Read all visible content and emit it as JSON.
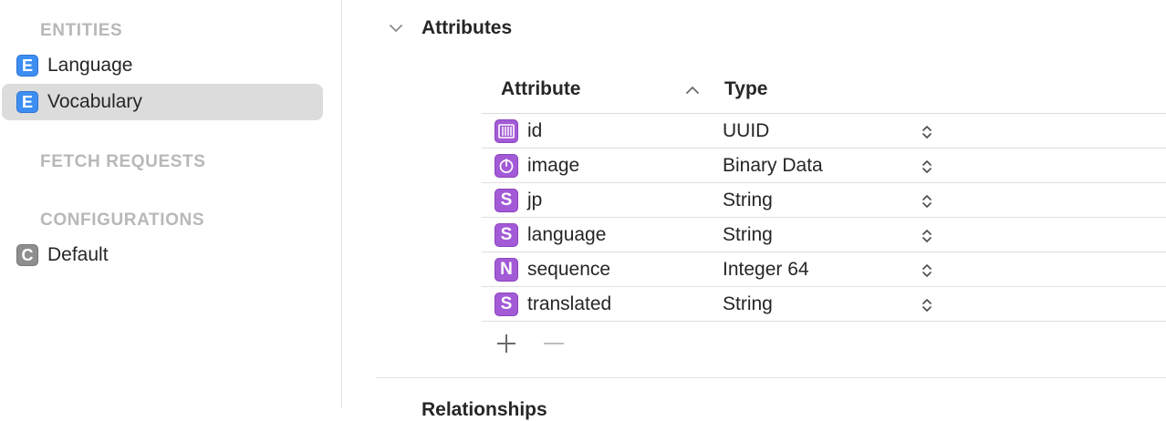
{
  "sidebar": {
    "entities_header": "ENTITIES",
    "entities": [
      {
        "badge": "E",
        "label": "Language",
        "selected": false
      },
      {
        "badge": "E",
        "label": "Vocabulary",
        "selected": true
      }
    ],
    "fetch_requests_header": "FETCH REQUESTS",
    "configurations_header": "CONFIGURATIONS",
    "configurations": [
      {
        "badge": "C",
        "label": "Default"
      }
    ]
  },
  "main": {
    "section_title": "Attributes",
    "next_section_title": "Relationships",
    "table": {
      "col_attribute": "Attribute",
      "col_type": "Type",
      "rows": [
        {
          "icon": "uuid-icon",
          "badge": "",
          "name": "id",
          "type": "UUID"
        },
        {
          "icon": "binary-data-icon",
          "badge": "",
          "name": "image",
          "type": "Binary Data"
        },
        {
          "icon": "string-icon",
          "badge": "S",
          "name": "jp",
          "type": "String"
        },
        {
          "icon": "string-icon",
          "badge": "S",
          "name": "language",
          "type": "String"
        },
        {
          "icon": "number-icon",
          "badge": "N",
          "name": "sequence",
          "type": "Integer 64"
        },
        {
          "icon": "string-icon",
          "badge": "S",
          "name": "translated",
          "type": "String"
        }
      ]
    }
  },
  "colors": {
    "entity_badge": "#3d8ef2",
    "attribute_badge": "#a35ad6",
    "config_badge": "#8e8e8e",
    "selection": "#dcdcdc",
    "section_header": "#b8b8b8"
  }
}
